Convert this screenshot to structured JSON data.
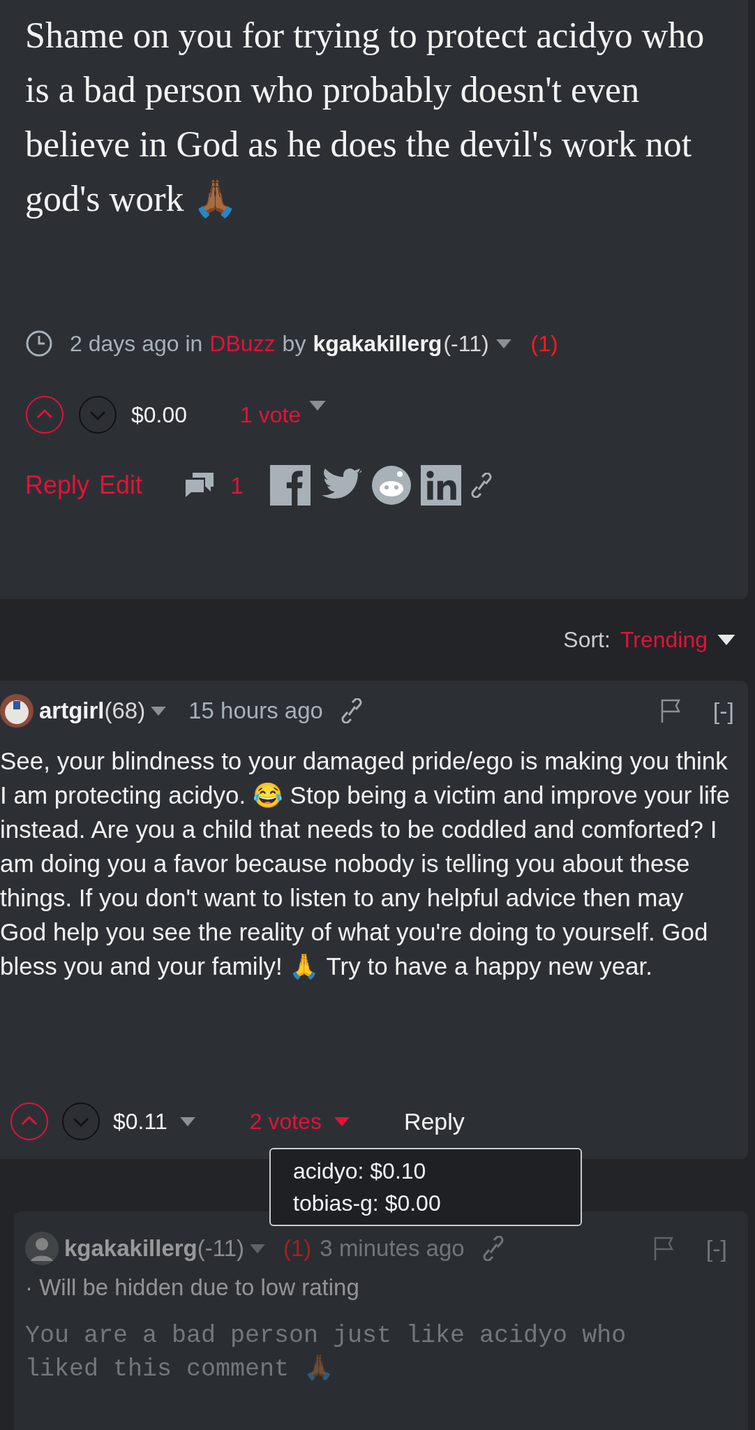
{
  "post": {
    "body": "Shame on you for trying to protect acidyo who is a bad person who probably doesn't even believe in God as he does the devil's work not god's work 🙏🏾",
    "meta": {
      "time": "2 days ago in",
      "community": "DBuzz",
      "by": "by",
      "author": "kgakakillerg",
      "reputation": "(-11)",
      "flag_count": "(1)"
    },
    "votes": {
      "upvoted": true,
      "payout": "$0.00",
      "votes_label": "1 vote"
    },
    "actions": {
      "reply": "Reply",
      "edit": "Edit",
      "comment_count": "1"
    }
  },
  "sort": {
    "label": "Sort:",
    "value": "Trending"
  },
  "comment": {
    "author": "artgirl",
    "reputation": "(68)",
    "time": "15 hours ago",
    "collapse": "[-]",
    "body": "See, your blindness to your damaged pride/ego is making you think I am protecting acidyo. 😂 Stop being a victim and improve your life instead. Are you a child that needs to be coddled and comforted? I am doing you a favor because nobody is telling you about these things. If you don't want to listen to any helpful advice then may God help you see the reality of what you're doing to yourself. God bless you and your family! 🙏 Try to have a happy new year.",
    "upvoted": true,
    "payout": "$0.11",
    "votes_label": "2 votes",
    "voters_open": true,
    "voters": [
      "acidyo: $0.10",
      "tobias-g: $0.00"
    ],
    "reply": "Reply"
  },
  "reply": {
    "author": "kgakakillerg",
    "reputation": "(-11)",
    "flag_count": "(1)",
    "time": "3 minutes ago",
    "collapse": "[-]",
    "hidden": true,
    "notice": "· Will be hidden due to low rating",
    "body": "You are a bad person just like acidyo who liked this comment 🙏🏾"
  }
}
